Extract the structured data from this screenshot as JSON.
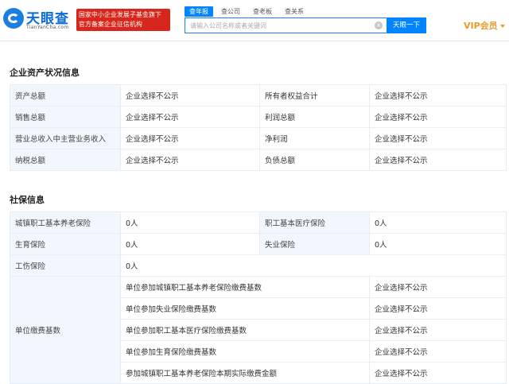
{
  "header": {
    "logo_cn": "天眼查",
    "logo_en": "TianYanCha.com",
    "badge_line1": "国家中小企业发展子基金旗下",
    "badge_line2": "官方备案企业征信机构",
    "tabs": [
      "查年报",
      "查公司",
      "查老板",
      "查关系"
    ],
    "search_placeholder": "请输入公司名称或者关键词",
    "clear_icon": "clear-circle-icon",
    "search_button": "天眼一下",
    "vip_label": "VIP会员"
  },
  "assets": {
    "title": "企业资产状况信息",
    "rows": [
      {
        "l1": "资产总额",
        "v1": "企业选择不公示",
        "l2": "所有者权益合计",
        "v2": "企业选择不公示"
      },
      {
        "l1": "销售总额",
        "v1": "企业选择不公示",
        "l2": "利润总额",
        "v2": "企业选择不公示"
      },
      {
        "l1": "营业总收入中主营业务收入",
        "v1": "企业选择不公示",
        "l2": "净利润",
        "v2": "企业选择不公示"
      },
      {
        "l1": "纳税总额",
        "v1": "企业选择不公示",
        "l2": "负债总额",
        "v2": "企业选择不公示"
      }
    ]
  },
  "social": {
    "title": "社保信息",
    "rows": [
      {
        "l1": "城镇职工基本养老保险",
        "v1": "0人",
        "l2": "职工基本医疗保险",
        "v2": "0人"
      },
      {
        "l1": "生育保险",
        "v1": "0人",
        "l2": "失业保险",
        "v2": "0人"
      }
    ],
    "injury_label": "工伤保险",
    "injury_value": "0人",
    "base_label": "单位缴费基数",
    "base_rows": [
      {
        "label": "单位参加城镇职工基本养老保险缴费基数",
        "value": "企业选择不公示"
      },
      {
        "label": "单位参加失业保险缴费基数",
        "value": "企业选择不公示"
      },
      {
        "label": "单位参加职工基本医疗保险缴费基数",
        "value": "企业选择不公示"
      },
      {
        "label": "单位参加生育保险缴费基数",
        "value": "企业选择不公示"
      },
      {
        "label": "参加城镇职工基本养老保险本期实际缴费金额",
        "value": "企业选择不公示"
      }
    ]
  },
  "colors": {
    "brand_blue": "#0084ff",
    "badge_red": "#d7261c",
    "vip_gold": "#e89a2a",
    "label_bg": "#f2f7fd"
  }
}
